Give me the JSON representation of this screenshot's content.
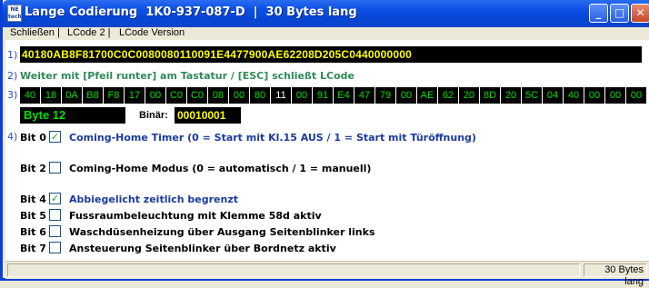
{
  "window": {
    "logo_text": "NE tech",
    "title": "Lange Codierung  1K0-937-087-D  |  30 Bytes lang",
    "minimize": "_",
    "maximize": "□",
    "close": "✕"
  },
  "menu": {
    "items": [
      "Schließen |",
      "LCode 2 |",
      "LCode Version"
    ]
  },
  "row_numbers": [
    "1)",
    "2)",
    "3)",
    "4)"
  ],
  "hex_code": "40180AB8F81700C0C0080080110091E4477900AE62208D205C0440000000",
  "instruction": "Weiter mit [Pfeil runter] am Tastatur / [ESC] schließt LCode",
  "bytes": [
    "40",
    "18",
    "0A",
    "B8",
    "F8",
    "17",
    "00",
    "C0",
    "C0",
    "08",
    "00",
    "80",
    "11",
    "00",
    "91",
    "E4",
    "47",
    "79",
    "00",
    "AE",
    "62",
    "20",
    "8D",
    "20",
    "5C",
    "04",
    "40",
    "00",
    "00",
    "00"
  ],
  "selected_byte_index": 12,
  "selected_byte_label": "Byte 12",
  "binaer_label": "Binär:",
  "binaer_value": "00010001",
  "bits": [
    {
      "label": "Bit 0",
      "checked": true,
      "text": "Coming-Home Timer (0 = Start mit Kl.15 AUS / 1 = Start mit Türöffnung)"
    },
    {
      "label": "Bit 2",
      "checked": false,
      "text": "Coming-Home Modus (0 = automatisch / 1 = manuell)"
    },
    {
      "label": "Bit 4",
      "checked": true,
      "text": "Abbiegelicht zeitlich begrenzt"
    },
    {
      "label": "Bit 5",
      "checked": false,
      "text": "Fussraumbeleuchtung mit Klemme 58d aktiv"
    },
    {
      "label": "Bit 6",
      "checked": false,
      "text": "Waschdüsenheizung über Ausgang Seitenblinker links"
    },
    {
      "label": "Bit 7",
      "checked": false,
      "text": "Ansteuerung Seitenblinker über Bordnetz aktiv"
    }
  ],
  "status": {
    "right": "30 Bytes lang"
  },
  "colors": {
    "titlebar": "#0a50e6",
    "hex_text": "#ffff00",
    "byte_text": "#00e000",
    "selected_byte_text": "#ffffff",
    "instruction": "#2e8b57",
    "checked_text": "#1a3a9e"
  }
}
